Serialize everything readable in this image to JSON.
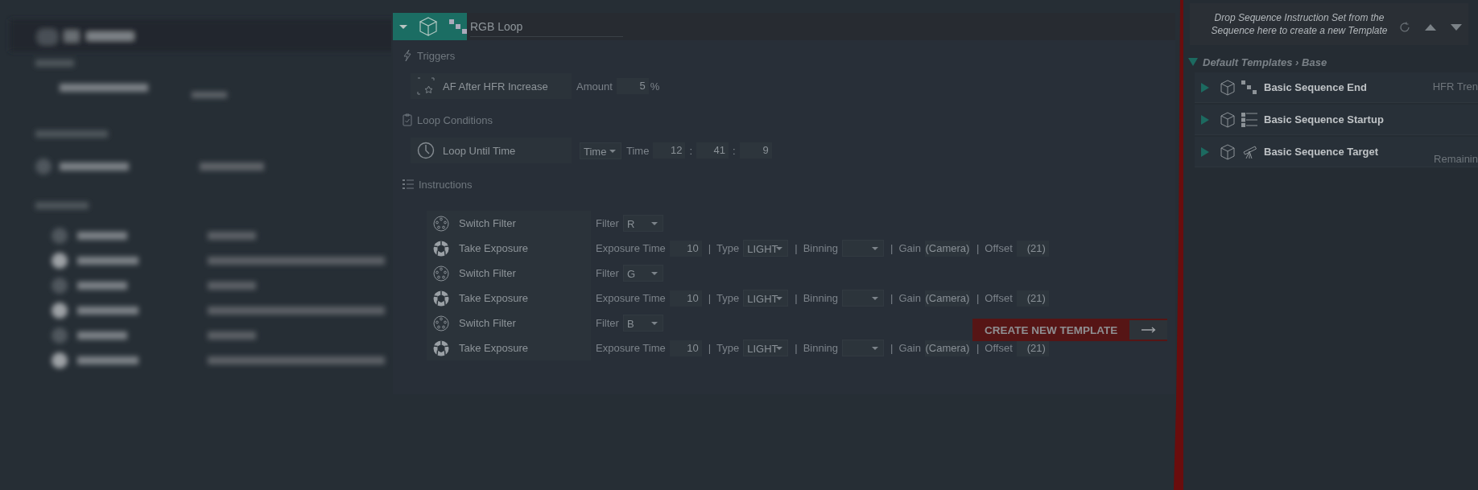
{
  "sequence": {
    "title": "RGB Loop",
    "expanded": true,
    "triggers": {
      "title": "Triggers",
      "items": [
        {
          "name": "AF After HFR Increase",
          "amount_label": "Amount",
          "amount": "5",
          "unit": "%"
        }
      ]
    },
    "loop_conditions": {
      "title": "Loop Conditions",
      "items": [
        {
          "name": "Loop Until Time",
          "mode": "Time",
          "time_label": "Time",
          "time": [
            "12",
            "41",
            "9"
          ],
          "separators": [
            ":",
            ":"
          ]
        }
      ]
    },
    "instructions": {
      "title": "Instructions",
      "items": [
        {
          "kind": "switch_filter",
          "name": "Switch Filter",
          "filter_label": "Filter",
          "filter": "R"
        },
        {
          "kind": "take_exposure",
          "name": "Take Exposure",
          "exposure_label": "Exposure Time",
          "exposure": "10",
          "type_label": "Type",
          "type": "LIGHT",
          "binning_label": "Binning",
          "gain_label": "Gain",
          "gain": "(Camera)",
          "offset_label": "Offset",
          "offset": "(21)",
          "separators": [
            "|",
            "|",
            "|",
            "|"
          ]
        },
        {
          "kind": "switch_filter",
          "name": "Switch Filter",
          "filter_label": "Filter",
          "filter": "G"
        },
        {
          "kind": "take_exposure",
          "name": "Take Exposure",
          "exposure_label": "Exposure Time",
          "exposure": "10",
          "type_label": "Type",
          "type": "LIGHT",
          "binning_label": "Binning",
          "gain_label": "Gain",
          "gain": "(Camera)",
          "offset_label": "Offset",
          "offset": "(21)",
          "separators": [
            "|",
            "|",
            "|",
            "|"
          ]
        },
        {
          "kind": "switch_filter",
          "name": "Switch Filter",
          "filter_label": "Filter",
          "filter": "B"
        },
        {
          "kind": "take_exposure",
          "name": "Take Exposure",
          "exposure_label": "Exposure Time",
          "exposure": "10",
          "type_label": "Type",
          "type": "LIGHT",
          "binning_label": "Binning",
          "gain_label": "Gain",
          "gain": "(Camera)",
          "offset_label": "Offset",
          "offset": "(21)",
          "separators": [
            "|",
            "|",
            "|",
            "|"
          ]
        }
      ]
    }
  },
  "create_button": {
    "label": "CREATE NEW TEMPLATE"
  },
  "templates": {
    "drop_hint": "Drop Sequence Instruction Set from the Sequence here to create a new Template",
    "breadcrumb": "Default Templates › Base",
    "expanded": true,
    "items": [
      {
        "kind": "end",
        "name": "Basic Sequence End",
        "expanded": false,
        "note": "HFR Tren"
      },
      {
        "kind": "startup",
        "name": "Basic Sequence Startup",
        "expanded": false
      },
      {
        "kind": "target",
        "name": "Basic Sequence Target",
        "expanded": false,
        "note": "Remainin"
      }
    ]
  }
}
